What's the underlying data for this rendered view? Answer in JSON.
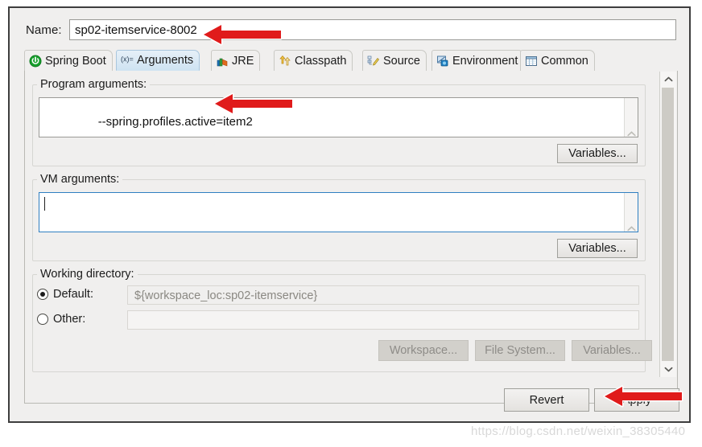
{
  "dialog": {
    "name_label": "Name:",
    "name_value": "sp02-itemservice-8002"
  },
  "tabs": [
    {
      "label": "Spring Boot",
      "icon": "spring-boot-icon",
      "selected": false
    },
    {
      "label": "Arguments",
      "icon": "arguments-icon",
      "selected": true
    },
    {
      "label": "JRE",
      "icon": "jre-books-icon",
      "selected": false
    },
    {
      "label": "Classpath",
      "icon": "classpath-arrows-icon",
      "selected": false
    },
    {
      "label": "Source",
      "icon": "source-pencil-icon",
      "selected": false
    },
    {
      "label": "Environment",
      "icon": "environment-icon",
      "selected": false
    },
    {
      "label": "Common",
      "icon": "common-table-icon",
      "selected": false
    }
  ],
  "program_arguments": {
    "group_label": "Program arguments:",
    "value": "--spring.profiles.active=item2",
    "variables_button": "Variables..."
  },
  "vm_arguments": {
    "group_label": "VM arguments:",
    "value": "",
    "variables_button": "Variables..."
  },
  "working_directory": {
    "group_label": "Working directory:",
    "default_label": "Default:",
    "default_value": "${workspace_loc:sp02-itemservice}",
    "default_selected": true,
    "other_label": "Other:",
    "other_value": "",
    "other_selected": false,
    "workspace_button": "Workspace...",
    "file_system_button": "File System...",
    "variables_button": "Variables..."
  },
  "footer": {
    "revert_button": "Revert",
    "apply_button": "Apply"
  },
  "watermark": {
    "text": "https://blog.csdn.net/weixin_38305440"
  },
  "colors": {
    "arrow_red": "#e01b1b",
    "selected_tab_blue": "#cfe3f2",
    "focus_border": "#2f7fc1",
    "window_bg": "#f0efee"
  }
}
